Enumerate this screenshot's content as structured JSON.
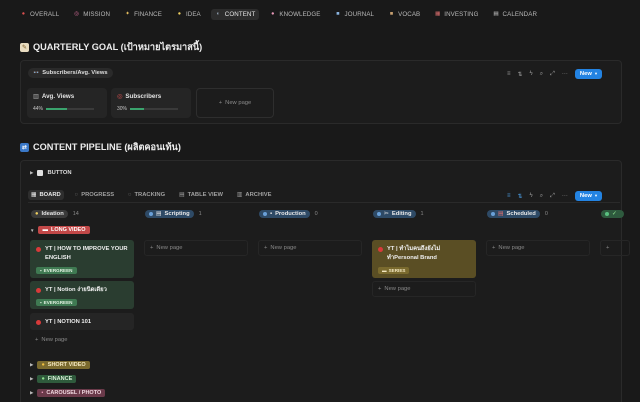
{
  "nav": {
    "tabs": [
      {
        "label": "OVERALL",
        "icon": "target-icon"
      },
      {
        "label": "MISSION",
        "icon": "mission-icon"
      },
      {
        "label": "FINANCE",
        "icon": "money-icon"
      },
      {
        "label": "IDEA",
        "icon": "bulb-icon"
      },
      {
        "label": "CONTENT",
        "icon": "content-icon"
      },
      {
        "label": "KNOWLEDGE",
        "icon": "brain-icon"
      },
      {
        "label": "JOURNAL",
        "icon": "journal-icon"
      },
      {
        "label": "VOCAB",
        "icon": "vocab-icon"
      },
      {
        "label": "INVESTING",
        "icon": "chart-icon"
      },
      {
        "label": "CALENDAR",
        "icon": "calendar-icon"
      }
    ]
  },
  "goal": {
    "heading": "QUARTERLY GOAL (เป้าหมายไตรมาสนี้)",
    "view_label": "Subscribers/Avg. Views",
    "new_label": "New",
    "new_page_label": "New page",
    "cards": [
      {
        "title": "Avg. Views",
        "progress_text": "44%",
        "progress": 0.44
      },
      {
        "title": "Subscribers",
        "progress_text": "30%",
        "progress": 0.3
      }
    ]
  },
  "pipeline": {
    "heading": "CONTENT PIPELINE (ผลิตคอนเท้น)",
    "button_label": "BUTTON",
    "new_label": "New",
    "new_page_label": "New page",
    "views": [
      {
        "label": "BOARD"
      },
      {
        "label": "PROGRESS"
      },
      {
        "label": "TRACKING"
      },
      {
        "label": "TABLE VIEW"
      },
      {
        "label": "ARCHIVE"
      }
    ],
    "columns": [
      {
        "label": "Ideation",
        "count": "14"
      },
      {
        "label": "Scripting",
        "count": "1"
      },
      {
        "label": "Production",
        "count": "0"
      },
      {
        "label": "Editing",
        "count": "1"
      },
      {
        "label": "Scheduled",
        "count": "0"
      },
      {
        "label": "",
        "count": ""
      }
    ],
    "groups": [
      {
        "label": "LONG VIDEO"
      },
      {
        "label": "SHORT VIDEO"
      },
      {
        "label": "FINANCE"
      },
      {
        "label": "CAROUSEL / PHOTO"
      }
    ],
    "cards": [
      {
        "title": "YT | HOW TO IMPROVE YOUR ENGLISH",
        "tag": "EVERGREEN"
      },
      {
        "title": "YT | Notion ง่ายนิดเดียว",
        "tag": "EVERGREEN"
      },
      {
        "title": "YT | NOTION 101",
        "tag": ""
      },
      {
        "title": "YT | ทำไมคนถึงยังไม่ทำPersonal Brand",
        "tag": "SERIES"
      }
    ]
  },
  "colors": {
    "background": "#191919",
    "accent": "#2383e2",
    "progress": "#3aa36d",
    "long_video": "#c24848",
    "evergreen": "#3f7a52",
    "series": "#7a6a2e"
  }
}
